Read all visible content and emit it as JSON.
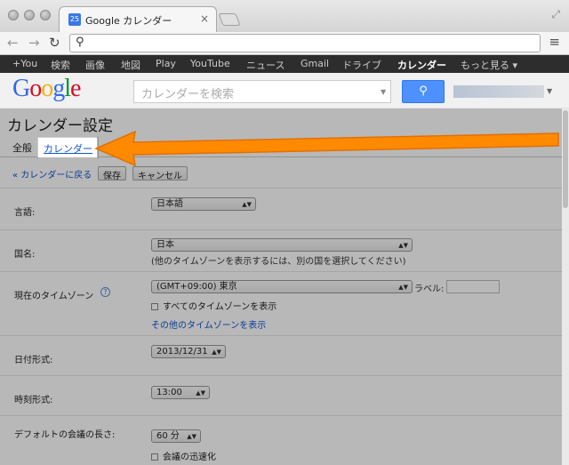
{
  "browser": {
    "tab_title": "Google カレンダー",
    "tab_favicon": "25"
  },
  "gbar": {
    "items": [
      "+You",
      "検索",
      "画像",
      "地図",
      "Play",
      "YouTube",
      "ニュース",
      "Gmail",
      "ドライブ",
      "カレンダー",
      "もっと見る ▾"
    ],
    "active_index": 9
  },
  "header": {
    "logo": "Google",
    "search_placeholder": "カレンダーを検索"
  },
  "settings": {
    "title": "カレンダー設定",
    "tab_general": "全般",
    "tab_calendars": "カレンダー",
    "back_link": "« カレンダーに戻る",
    "save": "保存",
    "cancel": "キャンセル",
    "language_label": "言語:",
    "language_value": "日本語",
    "country_label": "国名:",
    "country_value": "日本",
    "country_helper": "(他のタイムゾーンを表示するには、別の国を選択してください)",
    "timezone_label": "現在のタイムゾーン",
    "timezone_value": "(GMT+09:00) 東京",
    "label_text": "ラベル:",
    "show_all_tz": "すべてのタイムゾーンを表示",
    "other_tz_link": "その他のタイムゾーンを表示",
    "date_format_label": "日付形式:",
    "date_format_value": "2013/12/31",
    "time_format_label": "時刻形式:",
    "time_format_value": "13:00",
    "meeting_length_label": "デフォルトの会議の長さ:",
    "meeting_length_value": "60 分",
    "speedy_meetings": "会議の迅速化"
  }
}
